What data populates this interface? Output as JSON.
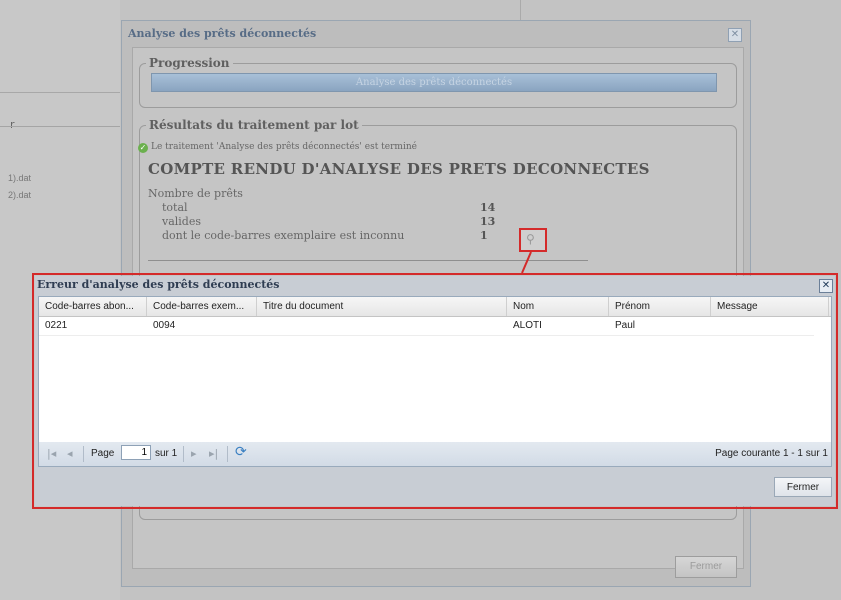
{
  "background": {
    "left_header": "r",
    "files": [
      "1).dat",
      "2).dat"
    ]
  },
  "dialog": {
    "title": "Analyse des prêts déconnectés",
    "close_glyph": "✕",
    "progress_legend": "Progression",
    "progress_text": "Analyse des prêts déconnectés",
    "results_legend": "Résultats du traitement par lot",
    "status_message": "Le traitement 'Analyse des prêts déconnectés' est terminé",
    "report_title": "COMPTE RENDU D'ANALYSE DES PRETS DECONNECTES",
    "report_subtitle": "Nombre de prêts",
    "report_rows": [
      {
        "label": "total",
        "value": "14"
      },
      {
        "label": "valides",
        "value": "13"
      },
      {
        "label": "dont le code-barres exemplaire est inconnu",
        "value": "1"
      }
    ],
    "magnifier_icon": "search-icon",
    "close_button": "Fermer"
  },
  "error_window": {
    "title": "Erreur d'analyse des prêts déconnectés",
    "close_glyph": "✕",
    "columns": [
      "Code-barres abon...",
      "Code-barres exem...",
      "Titre du document",
      "Nom",
      "Prénom",
      "Message"
    ],
    "rows": [
      [
        "0221",
        "0094",
        "",
        "ALOTI",
        "Paul",
        ""
      ]
    ],
    "pager": {
      "first": "|◂",
      "prev": "◂",
      "page_label": "Page",
      "page_value": "1",
      "of_label": "sur 1",
      "next": "▸",
      "last": "▸|",
      "refresh": "⟳",
      "status": "Page courante 1 - 1 sur 1"
    },
    "close_button": "Fermer"
  },
  "colors": {
    "highlight": "#d42a2a",
    "progress": "#8aa4c0",
    "ok": "#6bb04e"
  }
}
